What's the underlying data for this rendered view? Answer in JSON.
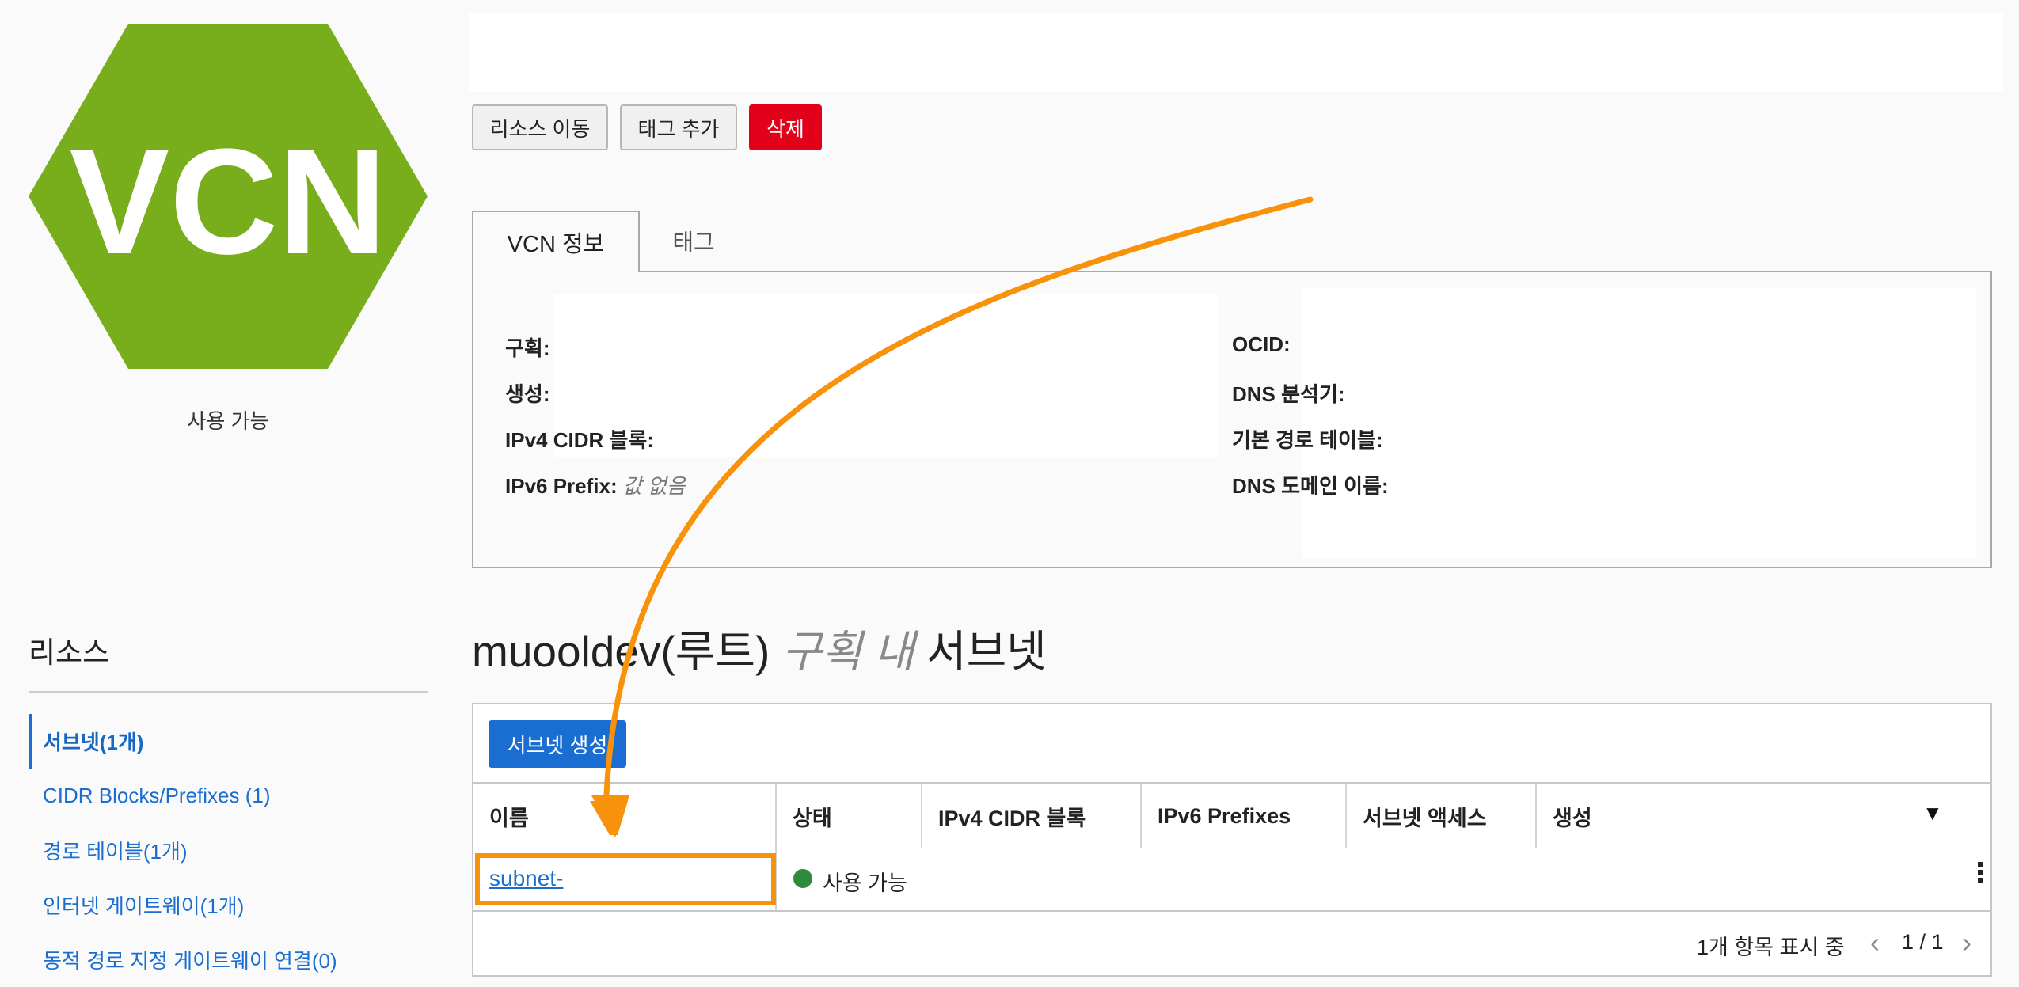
{
  "resource": {
    "icon_text": "VCN",
    "status": "사용 가능",
    "accent_color": "#78ad1b"
  },
  "actions": {
    "move": "리소스 이동",
    "add_tag": "태그 추가",
    "delete": "삭제"
  },
  "tabs": {
    "info": "VCN 정보",
    "tags": "태그"
  },
  "info": {
    "compartment_label": "구획:",
    "created_label": "생성:",
    "ipv4_label": "IPv4 CIDR 블록:",
    "ipv6_label": "IPv6 Prefix:",
    "ipv6_value": "값 없음",
    "ocid_label": "OCID:",
    "dns_resolver_label": "DNS 분석기:",
    "route_table_label": "기본 경로 테이블:",
    "dns_domain_label": "DNS 도메인 이름:"
  },
  "sidebar": {
    "title": "리소스",
    "items": [
      {
        "label": "서브넷(1개)"
      },
      {
        "label": "CIDR Blocks/Prefixes (1)"
      },
      {
        "label": "경로 테이블(1개)"
      },
      {
        "label": "인터넷 게이트웨이(1개)"
      },
      {
        "label": "동적 경로 지정 게이트웨이 연결(0)"
      }
    ]
  },
  "subnets": {
    "heading_compartment": "muooldev(루트)",
    "heading_in": "구획 내",
    "heading_suffix": "서브넷",
    "create_button": "서브넷 생성",
    "columns": [
      "이름",
      "상태",
      "IPv4 CIDR 블록",
      "IPv6 Prefixes",
      "서브넷 액세스",
      "생성"
    ],
    "rows": [
      {
        "name": "subnet-",
        "status": "사용 가능"
      }
    ],
    "pager_text": "1개 항목 표시 중",
    "pager_page": "1 / 1",
    "status_color": "#2f8a3b",
    "highlight_color": "#f7920a"
  }
}
